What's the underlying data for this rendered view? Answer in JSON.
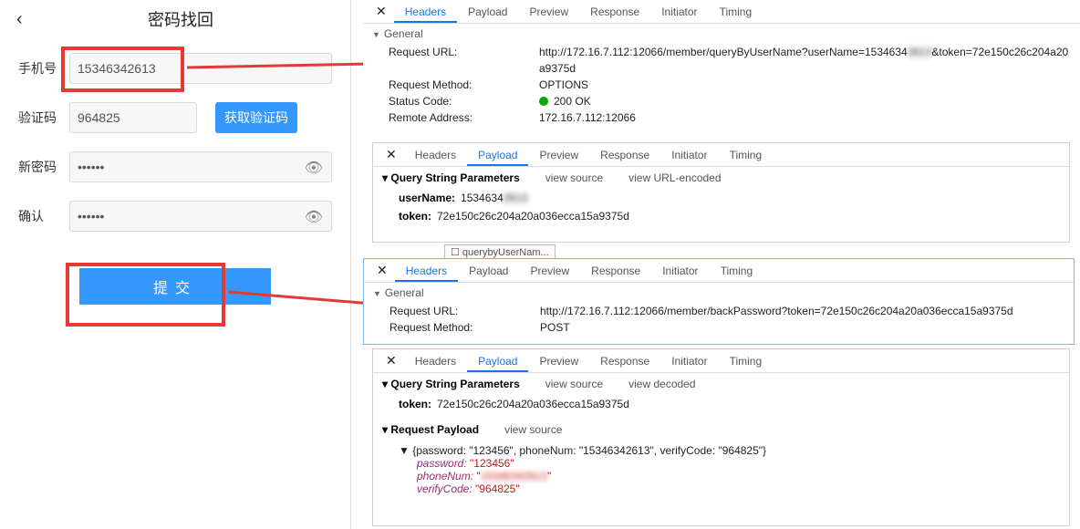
{
  "form": {
    "title": "密码找回",
    "phone_label": "手机号",
    "phone_value": "15346342613",
    "code_label": "验证码",
    "code_value": "964825",
    "get_code_btn": "获取验证码",
    "newpwd_label": "新密码",
    "newpwd_value": "••••••",
    "confirm_label": "确认",
    "confirm_value": "••••••",
    "submit_btn": "提交"
  },
  "filechip": "querybyUserNam...",
  "dev1": {
    "tabs": {
      "headers": "Headers",
      "payload": "Payload",
      "preview": "Preview",
      "response": "Response",
      "initiator": "Initiator",
      "timing": "Timing"
    },
    "general": "General",
    "req_url_k": "Request URL:",
    "req_url_v_a": "http://172.16.7.112:12066/member/queryByUserName?userName=1534634",
    "req_url_v_b": "&token=72e150c26c204a20",
    "req_url_v_c": "a9375d",
    "req_method_k": "Request Method:",
    "req_method_v": "OPTIONS",
    "status_k": "Status Code:",
    "status_v": "200 OK",
    "remote_k": "Remote Address:",
    "remote_v": "172.16.7.112:12066",
    "qsp_title": "Query String Parameters",
    "view_source": "view source",
    "view_url": "view URL-encoded",
    "user_k": "userName:",
    "user_v": "1534634",
    "token_k": "token:",
    "token_v": "72e150c26c204a20a036ecca15a9375d"
  },
  "dev2": {
    "general": "General",
    "req_url_k": "Request URL:",
    "req_url_v": "http://172.16.7.112:12066/member/backPassword?token=72e150c26c204a20a036ecca15a9375d",
    "req_method_k": "Request Method:",
    "req_method_v": "POST",
    "qsp_title": "Query String Parameters",
    "view_source": "view source",
    "view_decoded": "view decoded",
    "token_k": "token:",
    "token_v": "72e150c26c204a20a036ecca15a9375d",
    "rp_title": "Request Payload",
    "obj_line": "{password: \"123456\", phoneNum: \"15346342613\", verifyCode: \"964825\"}",
    "password_k": "password:",
    "password_v": "\"123456\"",
    "phone_k": "phoneNum:",
    "phone_v": "\"            \"",
    "verify_k": "verifyCode:",
    "verify_v": "\"964825\""
  }
}
